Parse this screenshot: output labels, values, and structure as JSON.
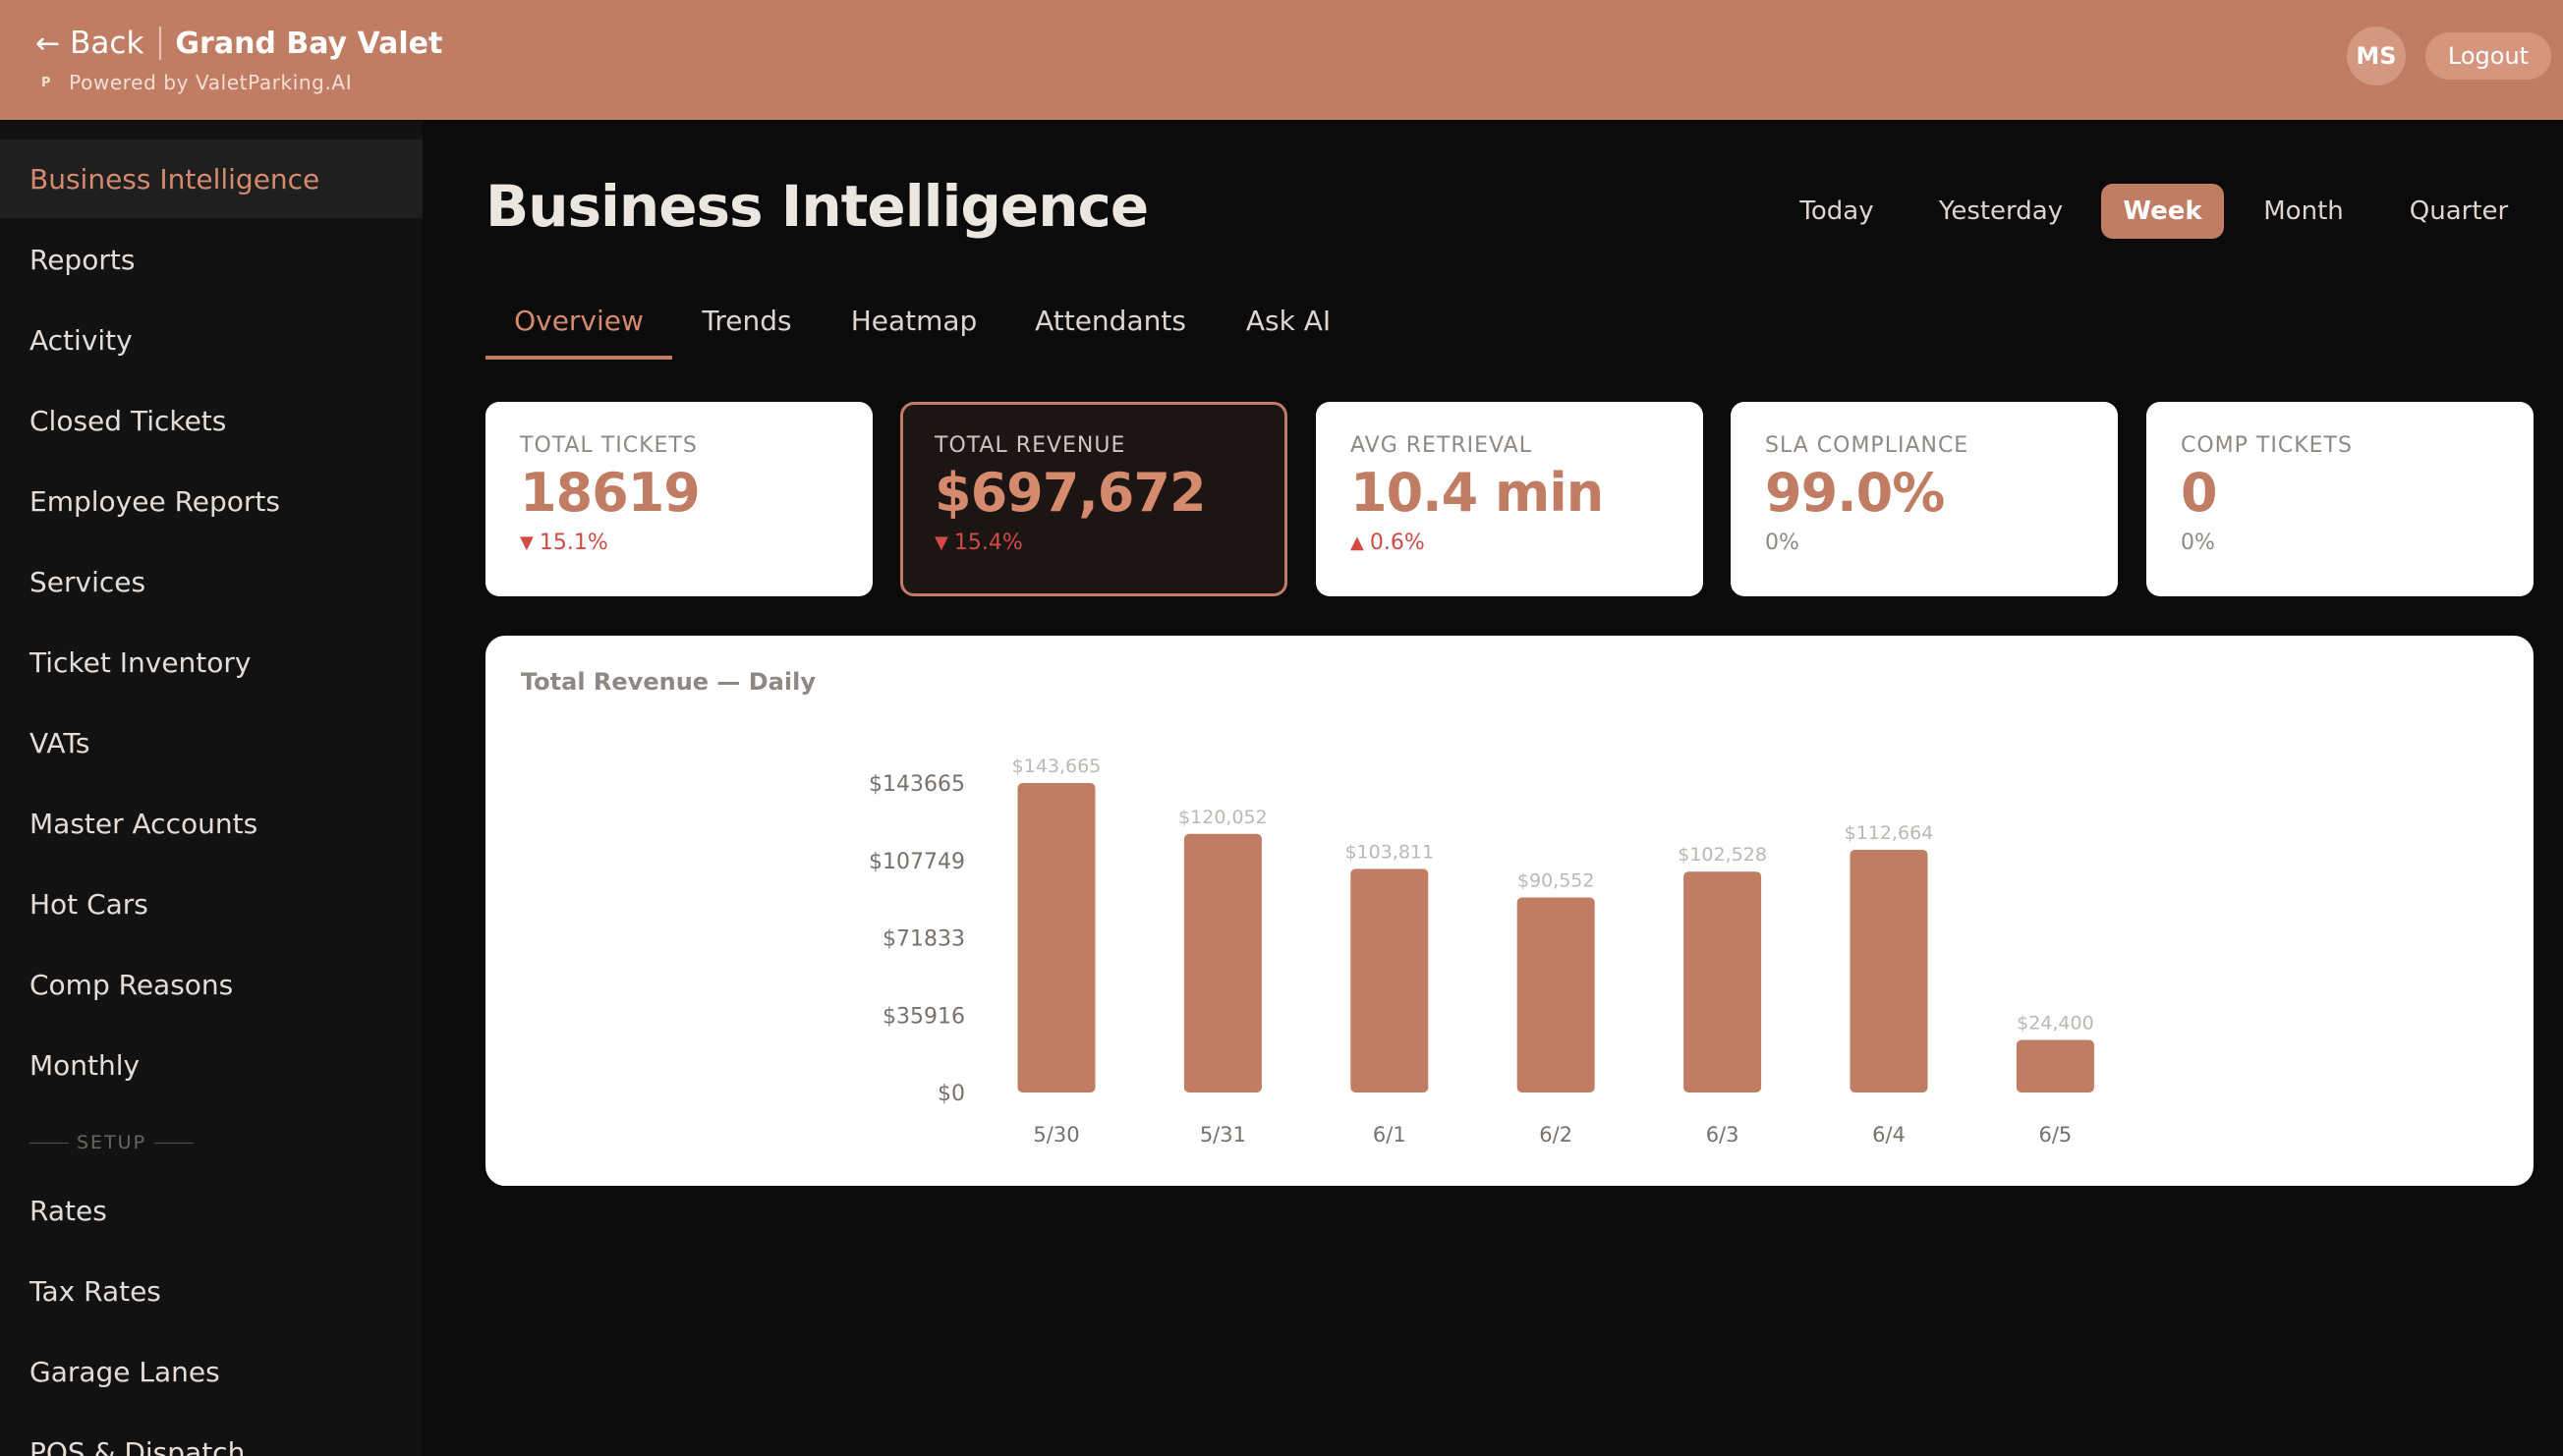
{
  "header": {
    "back_label": "Back",
    "venue_name": "Grand Bay Valet",
    "powered_icon": "P",
    "powered_by": "Powered by ValetParking.AI",
    "avatar_initials": "MS",
    "logout_label": "Logout",
    "color": "#c17d64"
  },
  "sidebar": {
    "items": [
      {
        "label": "Business Intelligence",
        "active": true
      },
      {
        "label": "Reports"
      },
      {
        "label": "Activity"
      },
      {
        "label": "Closed Tickets"
      },
      {
        "label": "Employee Reports"
      },
      {
        "label": "Services"
      },
      {
        "label": "Ticket Inventory"
      },
      {
        "label": "VATs"
      },
      {
        "label": "Master Accounts"
      },
      {
        "label": "Hot Cars"
      },
      {
        "label": "Comp Reasons"
      },
      {
        "label": "Monthly"
      }
    ],
    "section_label": "SETUP",
    "setup_items": [
      {
        "label": "Rates"
      },
      {
        "label": "Tax Rates"
      },
      {
        "label": "Garage Lanes"
      },
      {
        "label": "POS & Dispatch"
      }
    ]
  },
  "main": {
    "title": "Business Intelligence",
    "periods": [
      {
        "label": "Today"
      },
      {
        "label": "Yesterday"
      },
      {
        "label": "Week",
        "active": true
      },
      {
        "label": "Month"
      },
      {
        "label": "Quarter"
      }
    ],
    "tabs": [
      {
        "label": "Overview",
        "active": true
      },
      {
        "label": "Trends"
      },
      {
        "label": "Heatmap"
      },
      {
        "label": "Attendants"
      },
      {
        "label": "Ask AI"
      }
    ],
    "kpis": [
      {
        "label": "TOTAL TICKETS",
        "value": "18619",
        "delta": "15.1%",
        "direction": "down"
      },
      {
        "label": "TOTAL REVENUE",
        "value": "$697,672",
        "delta": "15.4%",
        "direction": "down",
        "highlighted": true
      },
      {
        "label": "AVG RETRIEVAL",
        "value": "10.4 min",
        "delta": "0.6%",
        "direction": "up"
      },
      {
        "label": "SLA COMPLIANCE",
        "value": "99.0%",
        "delta": "0%",
        "direction": "flat"
      },
      {
        "label": "COMP TICKETS",
        "value": "0",
        "delta": "0%",
        "direction": "flat"
      }
    ]
  },
  "chart_data": {
    "type": "bar",
    "title": "Total Revenue — Daily",
    "categories": [
      "5/30",
      "5/31",
      "6/1",
      "6/2",
      "6/3",
      "6/4",
      "6/5"
    ],
    "values": [
      143665,
      120052,
      103811,
      90552,
      102528,
      112664,
      24400
    ],
    "value_labels": [
      "$143,665",
      "$120,052",
      "$103,811",
      "$90,552",
      "$102,528",
      "$112,664",
      "$24,400"
    ],
    "y_ticks": [
      "$0",
      "$35916",
      "$71833",
      "$107749",
      "$143665"
    ],
    "ylim": [
      0,
      143665
    ],
    "bar_color": "#c17d64",
    "grid": false,
    "legend": false
  }
}
